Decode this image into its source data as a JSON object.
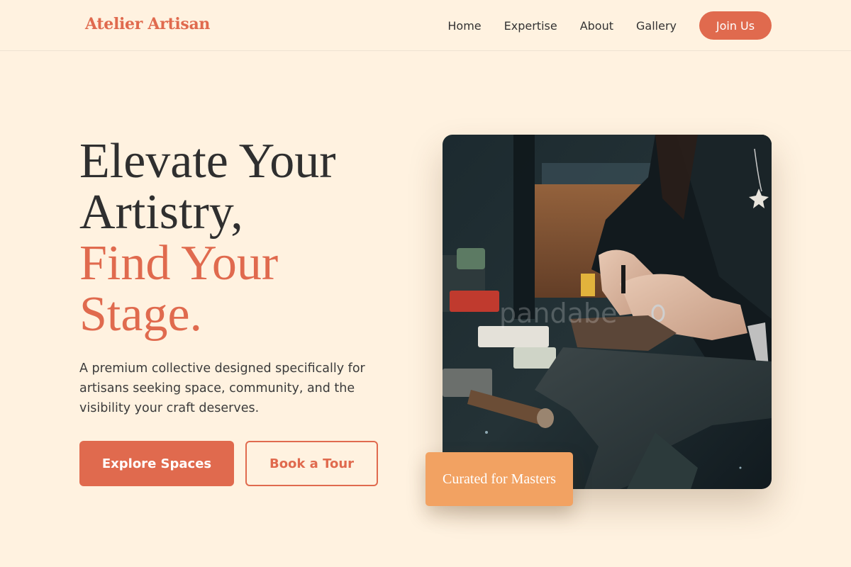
{
  "header": {
    "brand": "Atelier Artisan",
    "nav": [
      "Home",
      "Expertise",
      "About",
      "Gallery"
    ],
    "cta": "Join Us"
  },
  "hero": {
    "headline_line1": "Elevate Your",
    "headline_line2": "Artistry,",
    "headline_accent1": "Find Your",
    "headline_accent2": "Stage.",
    "subtitle": "A premium collective designed specifically for artisans seeking space, community, and the visibility your craft deserves.",
    "primary_button": "Explore Spaces",
    "secondary_button": "Book a Tour",
    "image_watermark": "pandabe",
    "badge": "Curated for Masters"
  },
  "colors": {
    "background": "#fff2e0",
    "accent": "#e06a4e",
    "badge": "#f2a262",
    "text": "#2f2f2f"
  }
}
